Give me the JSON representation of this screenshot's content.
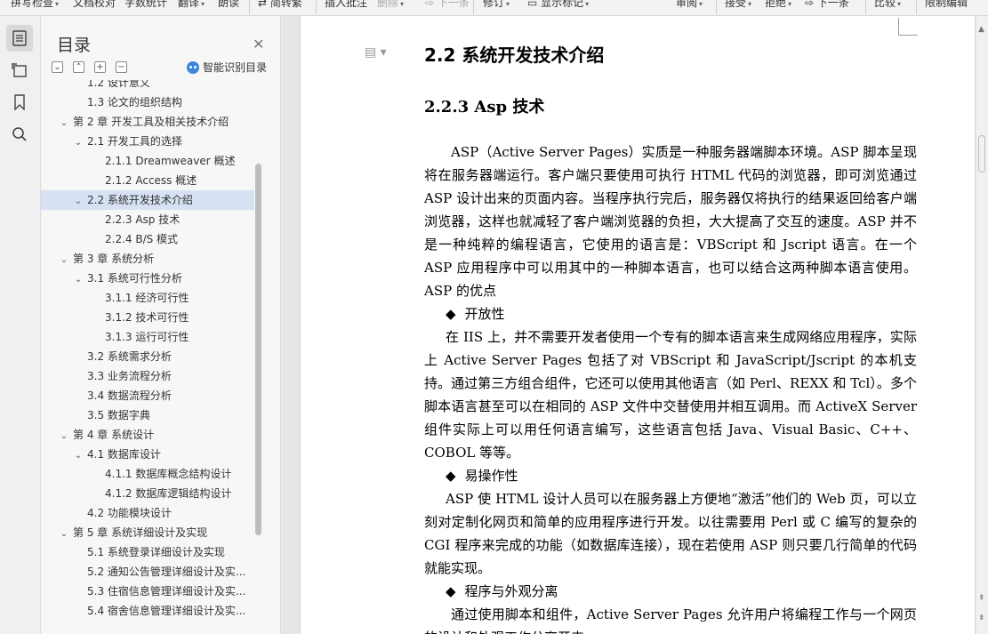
{
  "ribbon": {
    "items": [
      {
        "label": "拼写检查",
        "caret": true,
        "disabled": false
      },
      {
        "label": "文档校对",
        "caret": false,
        "disabled": false
      },
      {
        "label": "字数统计",
        "caret": false,
        "disabled": false
      },
      {
        "label": "翻译",
        "caret": true,
        "disabled": false
      },
      {
        "label": "朗读",
        "caret": false,
        "disabled": false
      },
      {
        "label": "简转繁",
        "caret": false,
        "disabled": false
      },
      {
        "label": "插入批注",
        "caret": false,
        "disabled": false
      },
      {
        "label": "删除",
        "caret": true,
        "disabled": true
      },
      {
        "label": "下一条",
        "caret": false,
        "disabled": true
      },
      {
        "label": "修订",
        "caret": true,
        "disabled": false
      },
      {
        "label": "显示标记",
        "caret": true,
        "disabled": false
      },
      {
        "label": "审阅",
        "caret": true,
        "disabled": false
      },
      {
        "label": "接受",
        "caret": true,
        "disabled": false
      },
      {
        "label": "拒绝",
        "caret": true,
        "disabled": false
      },
      {
        "label": "下一条",
        "caret": false,
        "disabled": false
      },
      {
        "label": "比较",
        "caret": true,
        "disabled": false
      },
      {
        "label": "限制编辑",
        "caret": false,
        "disabled": false
      }
    ]
  },
  "toc": {
    "title": "目录",
    "smart_label": "智能识别目录",
    "items": [
      {
        "label": "1.2  设计意义",
        "level": 2,
        "chevron": ""
      },
      {
        "label": "1.3  论文的组织结构",
        "level": 2,
        "chevron": ""
      },
      {
        "label": "第 2 章  开发工具及相关技术介绍",
        "level": 1,
        "chevron": "﹀"
      },
      {
        "label": "2.1  开发工具的选择",
        "level": 2,
        "chevron": "﹀"
      },
      {
        "label": "2.1.1 Dreamweaver 概述",
        "level": 3,
        "chevron": ""
      },
      {
        "label": "2.1.2 Access 概述",
        "level": 3,
        "chevron": ""
      },
      {
        "label": "2.2  系统开发技术介绍",
        "level": 2,
        "chevron": "﹀",
        "selected": true
      },
      {
        "label": "2.2.3 Asp 技术",
        "level": 3,
        "chevron": ""
      },
      {
        "label": "2.2.4 B/S 模式",
        "level": 3,
        "chevron": ""
      },
      {
        "label": "第 3 章  系统分析",
        "level": 1,
        "chevron": "﹀"
      },
      {
        "label": "3.1  系统可行性分析",
        "level": 2,
        "chevron": "﹀"
      },
      {
        "label": "3.1.1  经济可行性",
        "level": 3,
        "chevron": ""
      },
      {
        "label": "3.1.2  技术可行性",
        "level": 3,
        "chevron": ""
      },
      {
        "label": "3.1.3  运行可行性",
        "level": 3,
        "chevron": ""
      },
      {
        "label": "3.2  系统需求分析",
        "level": 2,
        "chevron": ""
      },
      {
        "label": "3.3  业务流程分析",
        "level": 2,
        "chevron": ""
      },
      {
        "label": "3.4  数据流程分析",
        "level": 2,
        "chevron": ""
      },
      {
        "label": "3.5  数据字典",
        "level": 2,
        "chevron": ""
      },
      {
        "label": "第 4 章  系统设计",
        "level": 1,
        "chevron": "﹀"
      },
      {
        "label": "4.1 数据库设计",
        "level": 2,
        "chevron": "﹀"
      },
      {
        "label": "4.1.1  数据库概念结构设计",
        "level": 3,
        "chevron": ""
      },
      {
        "label": "4.1.2  数据库逻辑结构设计",
        "level": 3,
        "chevron": ""
      },
      {
        "label": "4.2 功能模块设计",
        "level": 2,
        "chevron": ""
      },
      {
        "label": "第 5 章  系统详细设计及实现",
        "level": 1,
        "chevron": "﹀"
      },
      {
        "label": "5.1  系统登录详细设计及实现",
        "level": 2,
        "chevron": ""
      },
      {
        "label": "5.2  通知公告管理详细设计及实...",
        "level": 2,
        "chevron": ""
      },
      {
        "label": "5.3  住宿信息管理详细设计及实...",
        "level": 2,
        "chevron": ""
      },
      {
        "label": "5.4  宿舍信息管理详细设计及实...",
        "level": 2,
        "chevron": ""
      }
    ]
  },
  "doc": {
    "heading1": "2.2  系统开发技术介绍",
    "heading2": "2.2.3 Asp 技术",
    "p1": "ASP（Active Server Pages）实质是一种服务器端脚本环境。ASP 脚本呈现将在服务器端运行。客户端只要使用可执行 HTML 代码的浏览器，即可浏览通过 ASP 设计出来的页面内容。当程序执行完后，服务器仅将执行的结果返回给客户端浏览器，这样也就减轻了客户端浏览器的负担，大大提高了交互的速度。ASP 并不是一种纯粹的编程语言，它使用的语言是：VBScript 和 Jscript 语言。在一个 ASP 应用程序中可以用其中的一种脚本语言，也可以结合这两种脚本语言使用。ASP 的优点",
    "b1": "开放性",
    "p2": "在 IIS 上，并不需要开发者使用一个专有的脚本语言来生成网络应用程序，实际上 Active Server Pages 包括了对 VBScript 和 JavaScript/Jscript 的本机支持。通过第三方组合组件，它还可以使用其他语言（如 Perl、REXX 和 Tcl）。多个脚本语言甚至可以在相同的 ASP 文件中交替使用并相互调用。而 ActiveX Server 组件实际上可以用任何语言编写，这些语言包括 Java、Visual Basic、C++、COBOL 等等。",
    "b2": "易操作性",
    "p3": "ASP 使 HTML 设计人员可以在服务器上方便地“激活”他们的 Web 页，可以立刻对定制化网页和简单的应用程序进行开发。以往需要用 Perl 或 C 编写的复杂的 CGI 程序来完成的功能（如数据库连接），现在若使用 ASP 则只要几行简单的代码就能实现。",
    "b3": "程序与外观分离",
    "p4": "通过使用脚本和组件，Active Server Pages 允许用户将编程工作与一个网页的设计和外观工作分离开来。",
    "bullet_glyph": "◆"
  }
}
